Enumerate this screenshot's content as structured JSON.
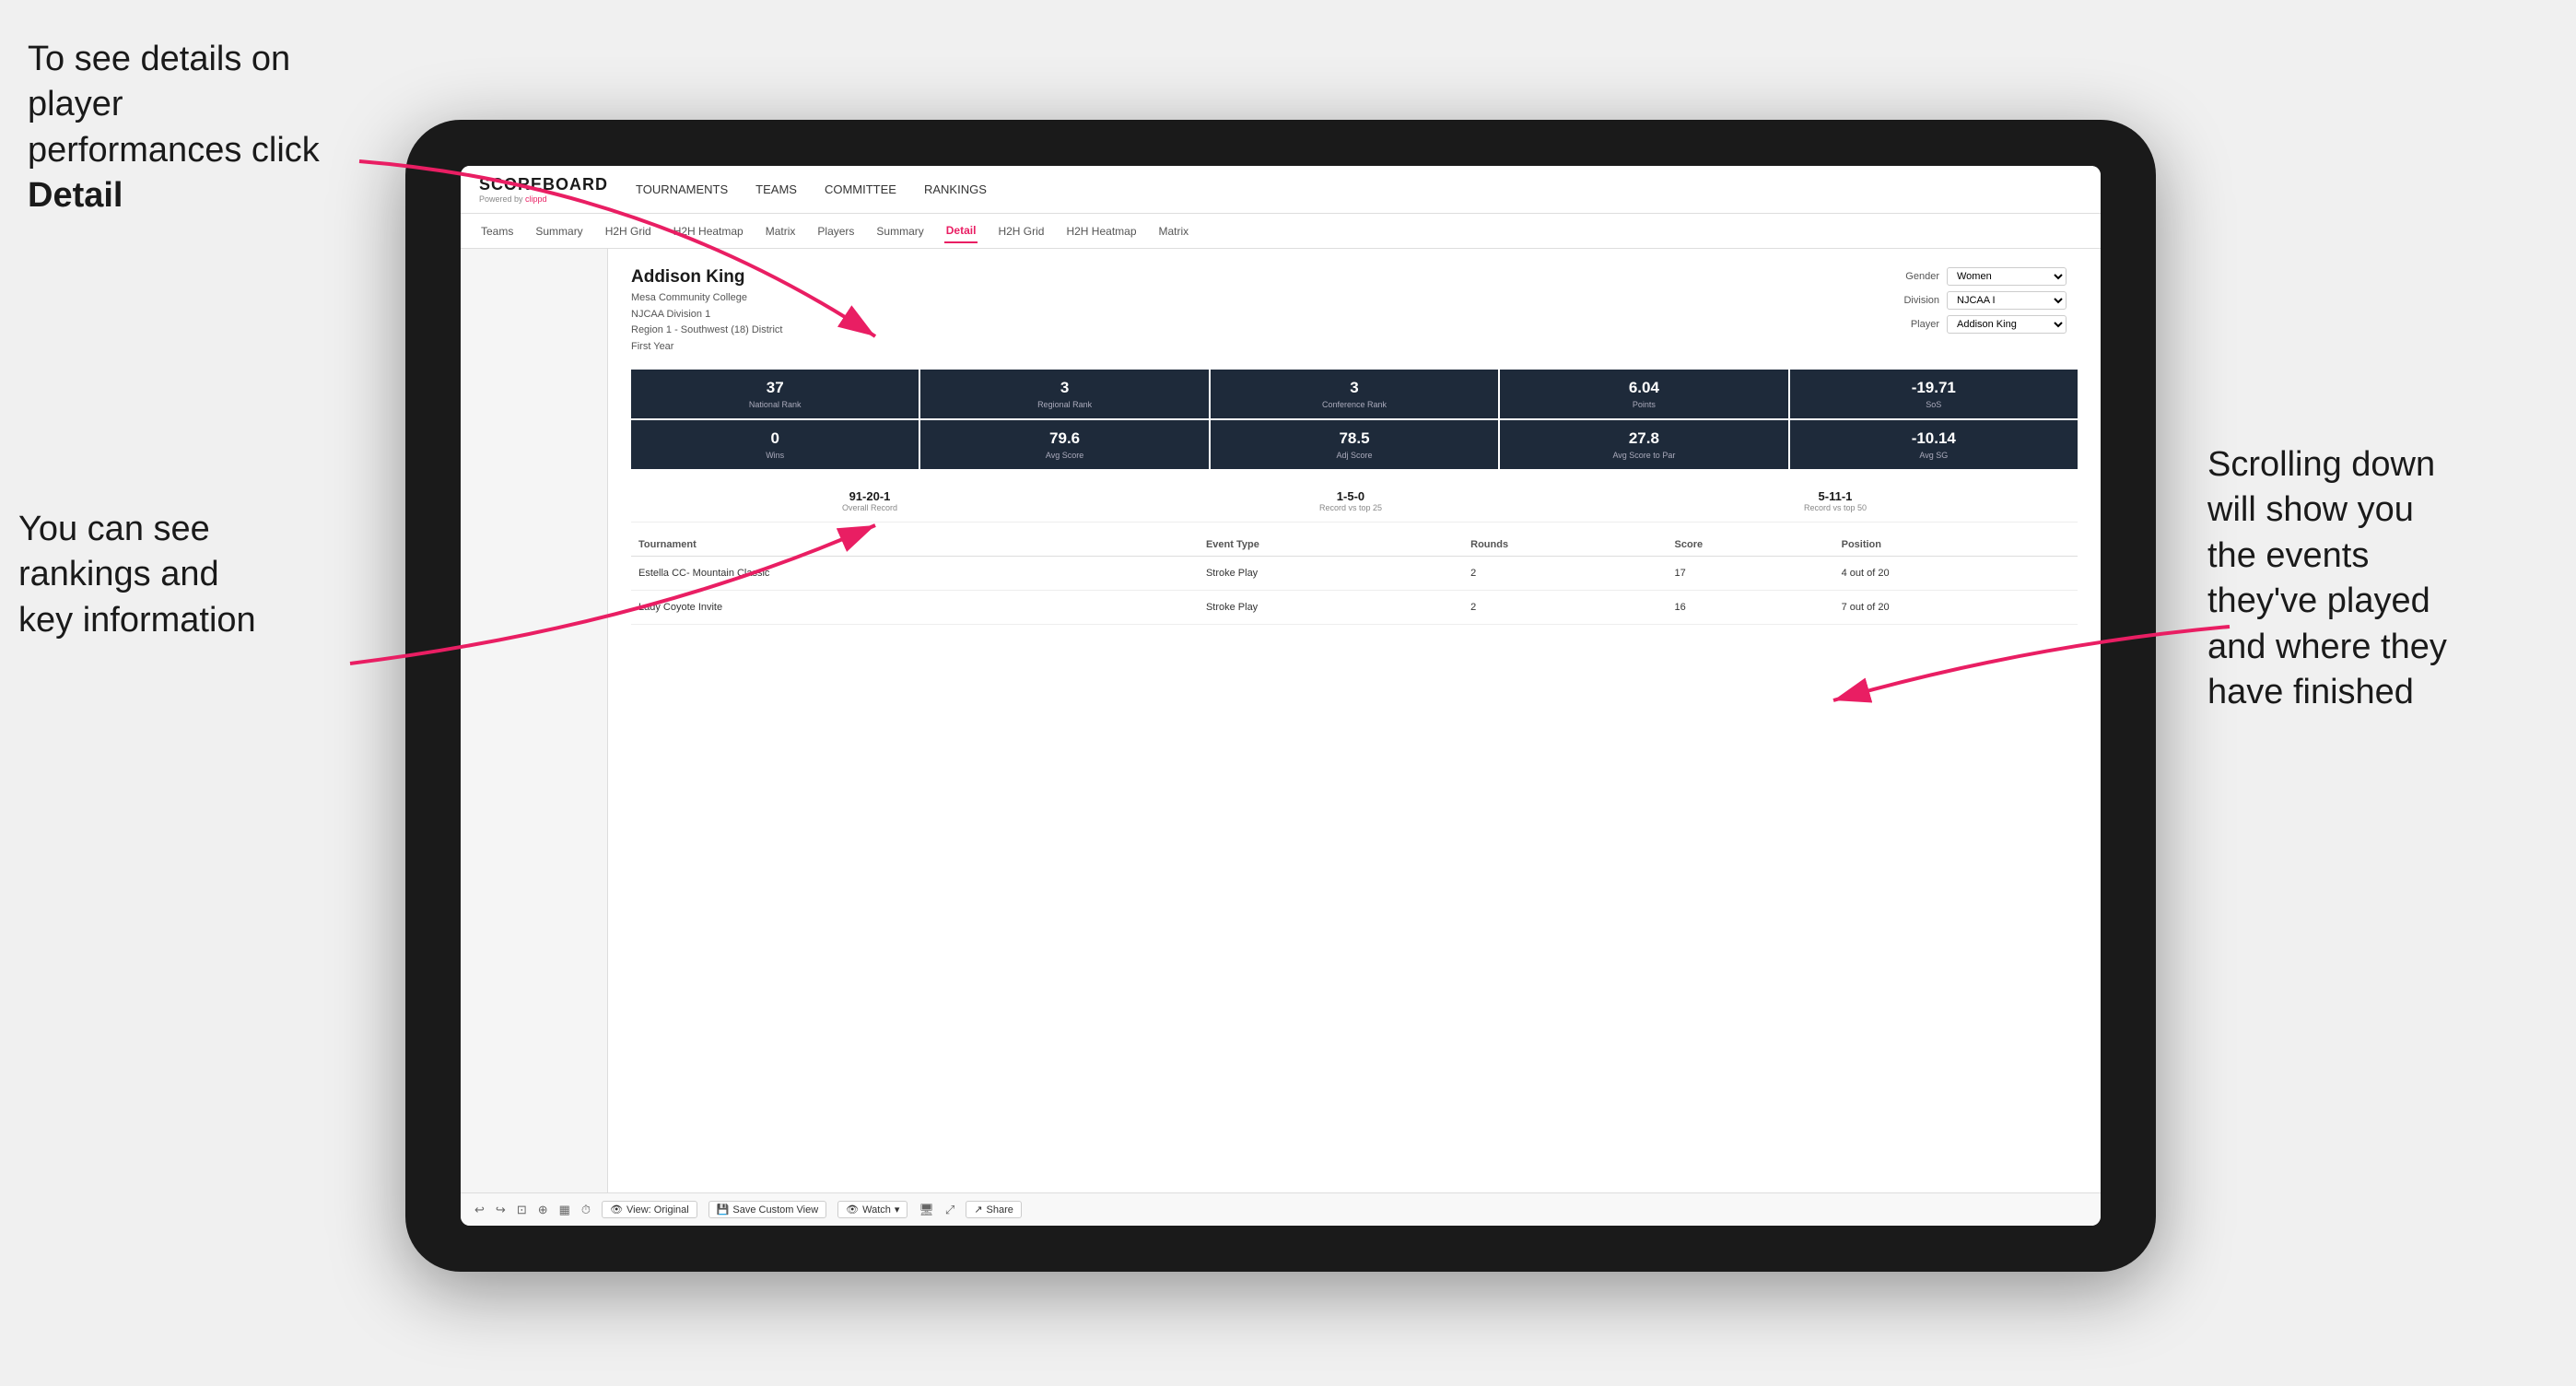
{
  "annotations": {
    "top_left": "To see details on player performances click ",
    "top_left_bold": "Detail",
    "bottom_left_line1": "You can see",
    "bottom_left_line2": "rankings and",
    "bottom_left_line3": "key information",
    "right_line1": "Scrolling down",
    "right_line2": "will show you",
    "right_line3": "the events",
    "right_line4": "they've played",
    "right_line5": "and where they",
    "right_line6": "have finished"
  },
  "nav": {
    "logo": "SCOREBOARD",
    "powered_by": "Powered by ",
    "clippd": "clippd",
    "items": [
      "TOURNAMENTS",
      "TEAMS",
      "COMMITTEE",
      "RANKINGS"
    ]
  },
  "sub_nav": {
    "items": [
      "Teams",
      "Summary",
      "H2H Grid",
      "H2H Heatmap",
      "Matrix",
      "Players",
      "Summary",
      "Detail",
      "H2H Grid",
      "H2H Heatmap",
      "Matrix"
    ],
    "active": "Detail"
  },
  "player": {
    "name": "Addison King",
    "school": "Mesa Community College",
    "division": "NJCAA Division 1",
    "region": "Region 1 - Southwest (18) District",
    "year": "First Year"
  },
  "filters": {
    "gender_label": "Gender",
    "gender_value": "Women",
    "division_label": "Division",
    "division_value": "NJCAA I",
    "player_label": "Player",
    "player_value": "Addison King"
  },
  "stats_row1": [
    {
      "value": "37",
      "label": "National Rank"
    },
    {
      "value": "3",
      "label": "Regional Rank"
    },
    {
      "value": "3",
      "label": "Conference Rank"
    },
    {
      "value": "6.04",
      "label": "Points"
    },
    {
      "value": "-19.71",
      "label": "SoS"
    }
  ],
  "stats_row2": [
    {
      "value": "0",
      "label": "Wins"
    },
    {
      "value": "79.6",
      "label": "Avg Score"
    },
    {
      "value": "78.5",
      "label": "Adj Score"
    },
    {
      "value": "27.8",
      "label": "Avg Score to Par"
    },
    {
      "value": "-10.14",
      "label": "Avg SG"
    }
  ],
  "records": [
    {
      "value": "91-20-1",
      "label": "Overall Record"
    },
    {
      "value": "1-5-0",
      "label": "Record vs top 25"
    },
    {
      "value": "5-11-1",
      "label": "Record vs top 50"
    }
  ],
  "table": {
    "headers": [
      "Tournament",
      "Event Type",
      "Rounds",
      "Score",
      "Position"
    ],
    "rows": [
      {
        "tournament": "Estella CC- Mountain Classic",
        "event_type": "Stroke Play",
        "rounds": "2",
        "score": "17",
        "position": "4 out of 20"
      },
      {
        "tournament": "Lady Coyote Invite",
        "event_type": "Stroke Play",
        "rounds": "2",
        "score": "16",
        "position": "7 out of 20"
      }
    ]
  },
  "toolbar": {
    "view_original": "View: Original",
    "save_custom": "Save Custom View",
    "watch": "Watch",
    "share": "Share"
  }
}
